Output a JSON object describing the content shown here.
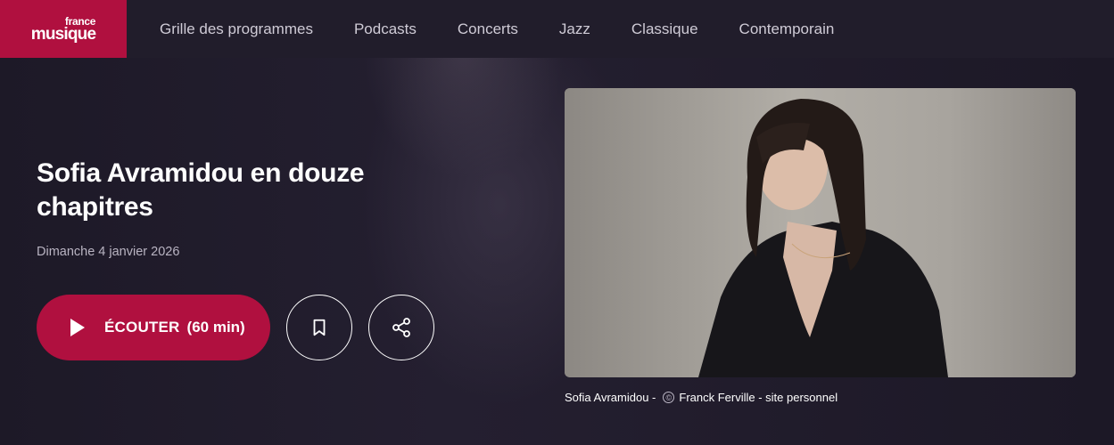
{
  "logo": {
    "line1": "france",
    "line2": "musique",
    "color": "#b0103f"
  },
  "nav": {
    "items": [
      "Grille des programmes",
      "Podcasts",
      "Concerts",
      "Jazz",
      "Classique",
      "Contemporain"
    ]
  },
  "episode": {
    "title": "Sofia Avramidou en douze chapitres",
    "date": "Dimanche 4 janvier 2026",
    "listen_label": "ÉCOUTER",
    "duration": "(60 min)"
  },
  "actions": {
    "bookmark_icon": "bookmark-icon",
    "share_icon": "share-icon"
  },
  "photo": {
    "caption_name": "Sofia Avramidou -",
    "caption_credit": "Franck Ferville - site personnel",
    "copyright_symbol": "©"
  }
}
